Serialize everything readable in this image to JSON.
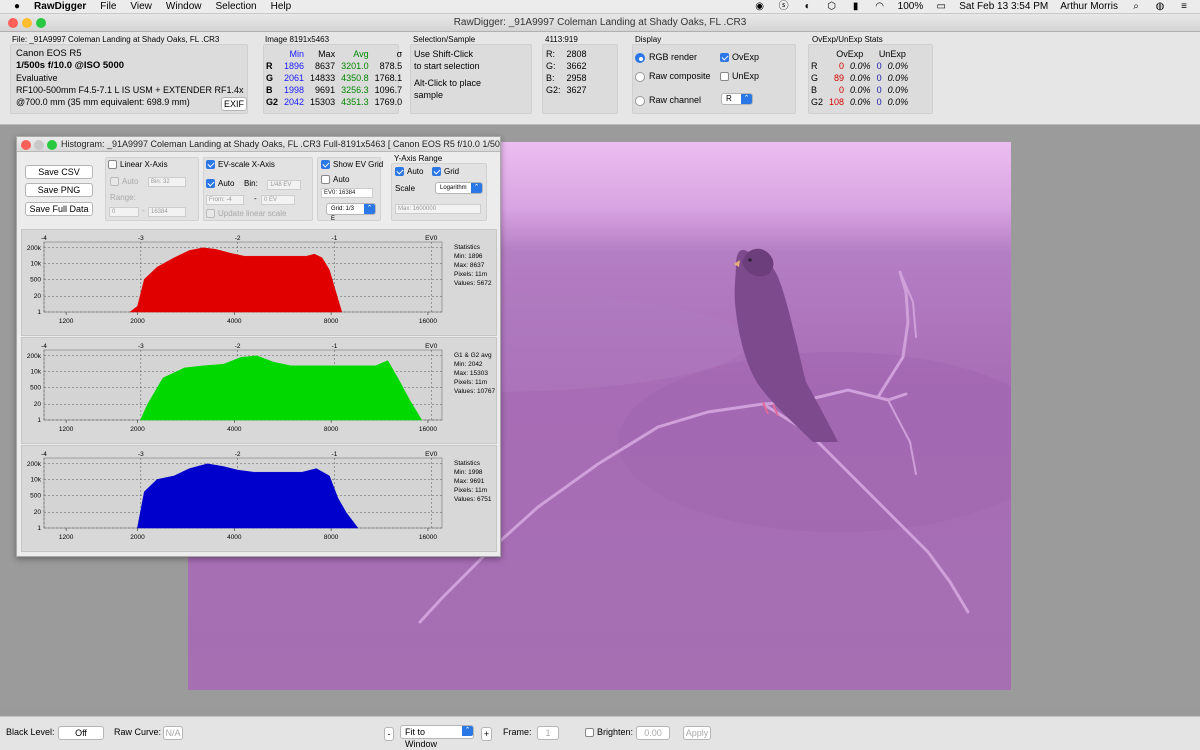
{
  "menubar": {
    "app_name": "RawDigger",
    "menus": [
      "File",
      "View",
      "Window",
      "Selection",
      "Help"
    ],
    "battery": "100%",
    "datetime": "Sat Feb 13  3:54 PM",
    "user": "Arthur Morris"
  },
  "window": {
    "title": "RawDigger: _91A9997  Coleman Landing at Shady Oaks, FL .CR3"
  },
  "file_info": {
    "file_line": "File: _91A9997  Coleman Landing at Shady Oaks, FL .CR3",
    "camera": "Canon EOS R5",
    "exposure": "1/500s f/10.0 @ISO 5000",
    "metering": "Evaluative",
    "lens": "RF100-500mm F4.5-7.1 L IS USM + EXTENDER RF1.4x",
    "focal": "@700.0 mm (35 mm equivalent: 698.9 mm)",
    "exif_button": "EXIF"
  },
  "image_stats": {
    "label": "Image 8191x5463",
    "headers": [
      "Min",
      "Max",
      "Avg",
      "σ"
    ],
    "rows": [
      {
        "ch": "R",
        "min": "1896",
        "max": "8637",
        "avg": "3201.0",
        "sd": "878.5"
      },
      {
        "ch": "G",
        "min": "2061",
        "max": "14833",
        "avg": "4350.8",
        "sd": "1768.1"
      },
      {
        "ch": "B",
        "min": "1998",
        "max": "9691",
        "avg": "3256.3",
        "sd": "1096.7"
      },
      {
        "ch": "G2",
        "min": "2042",
        "max": "15303",
        "avg": "4351.3",
        "sd": "1769.0"
      }
    ]
  },
  "selection": {
    "label": "Selection/Sample",
    "line1": "Use Shift-Click",
    "line2": "to start selection",
    "line3": "Alt-Click to place",
    "line4": "sample"
  },
  "sample": {
    "label": "4113:919",
    "rows": [
      {
        "ch": "R:",
        "val": "2808"
      },
      {
        "ch": "G:",
        "val": "3662"
      },
      {
        "ch": "B:",
        "val": "2958"
      },
      {
        "ch": "G2:",
        "val": "3627"
      }
    ]
  },
  "display": {
    "label": "Display",
    "rgb_render": "RGB render",
    "raw_composite": "Raw composite",
    "raw_channel": "Raw channel",
    "ovexp": "OvExp",
    "unexp": "UnExp",
    "channel_value": "R"
  },
  "ovexp_stats": {
    "label": "OvExp/UnExp Stats",
    "headers": [
      "OvExp",
      "UnExp"
    ],
    "rows": [
      {
        "ch": "R",
        "ov": "0",
        "ovp": "0.0%",
        "un": "0",
        "unp": "0.0%"
      },
      {
        "ch": "G",
        "ov": "89",
        "ovp": "0.0%",
        "un": "0",
        "unp": "0.0%"
      },
      {
        "ch": "B",
        "ov": "0",
        "ovp": "0.0%",
        "un": "0",
        "unp": "0.0%"
      },
      {
        "ch": "G2",
        "ov": "108",
        "ovp": "0.0%",
        "un": "0",
        "unp": "0.0%"
      }
    ]
  },
  "histogram": {
    "title": "Histogram: _91A9997  Coleman Landing at Shady Oaks, FL .CR3 Full-8191x5463 [ Canon EOS R5 f/10.0 1/500...",
    "save_csv": "Save CSV",
    "save_png": "Save PNG",
    "save_full": "Save Full Data",
    "linear_x": "Linear X-Axis",
    "auto": "Auto",
    "bin_field": "Bin: 32",
    "range": "Range:",
    "range_from": "0",
    "range_to": "16384",
    "ev_scale": "EV-scale X-Axis",
    "bin": "Bin:",
    "bin_ev": "1/48 EV",
    "from": "From: -4",
    "to": "0 EV",
    "update_linear": "Update linear scale",
    "show_ev_grid": "Show EV Grid",
    "ev0": "EV0: 16384",
    "grid": "Grid: 1/3 E",
    "y_range": "Y-Axis Range",
    "grid_label": "Grid",
    "scale": "Scale",
    "scale_value": "Logarithm",
    "max_field": "Max: 1600000",
    "ev_ticks": [
      "-4",
      "-3",
      "-2",
      "-1",
      "EV0"
    ],
    "y_ticks": [
      "200k",
      "10k",
      "500",
      "20",
      "1"
    ],
    "x_ticks": [
      "1200",
      "2000",
      "4000",
      "8000",
      "16000"
    ]
  },
  "chart_data": [
    {
      "type": "area",
      "name": "R",
      "color": "#e00000",
      "stats": [
        "Statistics",
        "Min: 1896",
        "Max: 8637",
        "Pixels: 11m",
        "Values: 5672"
      ],
      "x": [
        1896,
        2000,
        2100,
        2300,
        2600,
        2900,
        3200,
        3500,
        3900,
        4300,
        4800,
        5300,
        5800,
        6300,
        6700,
        7100,
        7500,
        7900,
        8200,
        8637
      ],
      "y": [
        1,
        3,
        500,
        5000,
        30000,
        120000,
        200000,
        150000,
        70000,
        40000,
        40000,
        40000,
        40000,
        40000,
        40000,
        60000,
        30000,
        3000,
        100,
        1
      ]
    },
    {
      "type": "area",
      "name": "G1 & G2 avg",
      "color": "#00d800",
      "stats": [
        "G1 & G2 avg",
        "Min: 2042",
        "Max: 15303",
        "Pixels: 11m",
        "Values: 10767"
      ],
      "x": [
        2042,
        2150,
        2400,
        2800,
        3200,
        3700,
        4200,
        4700,
        5300,
        6000,
        7000,
        8000,
        9000,
        10000,
        11000,
        12000,
        13000,
        14000,
        15303
      ],
      "y": [
        1,
        20,
        3000,
        20000,
        30000,
        40000,
        150000,
        200000,
        60000,
        30000,
        30000,
        30000,
        30000,
        30000,
        30000,
        80000,
        2000,
        50,
        1
      ]
    },
    {
      "type": "area",
      "name": "B",
      "color": "#0000cc",
      "stats": [
        "Statistics",
        "Min: 1998",
        "Max: 9691",
        "Pixels: 11m",
        "Values: 6751"
      ],
      "x": [
        1998,
        2100,
        2300,
        2600,
        2900,
        3300,
        3700,
        4100,
        4600,
        5200,
        5800,
        6500,
        7200,
        7900,
        8400,
        8900,
        9691
      ],
      "y": [
        1,
        1000,
        10000,
        20000,
        80000,
        200000,
        120000,
        60000,
        40000,
        40000,
        40000,
        40000,
        80000,
        20000,
        300,
        20,
        1
      ]
    }
  ],
  "bottombar": {
    "black_level": "Black Level:",
    "black_value": "Off",
    "raw_curve": "Raw Curve:",
    "raw_curve_value": "N/A",
    "minus": "-",
    "fit": "Fit to Window",
    "plus": "+",
    "frame": "Frame:",
    "frame_value": "1",
    "brighten": "Brighten:",
    "brighten_value": "0.00",
    "apply": "Apply"
  },
  "colors": {
    "accent": "#2b77e6",
    "photo": "#a86cb6"
  }
}
